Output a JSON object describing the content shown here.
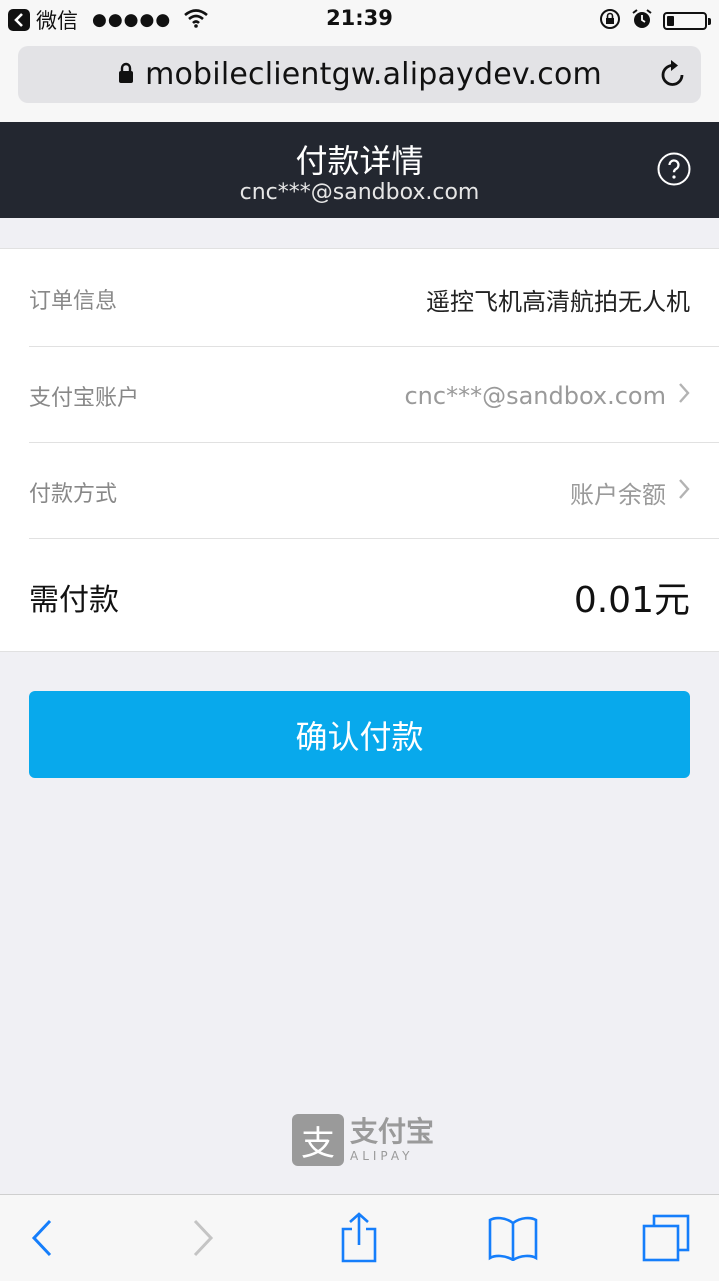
{
  "status_bar": {
    "back_app": "微信",
    "signal": "●●●●●",
    "time": "21:39",
    "battery_level": 0.2
  },
  "browser": {
    "url": "mobileclientgw.alipaydev.com"
  },
  "header": {
    "title": "付款详情",
    "account": "cnc***@sandbox.com",
    "help_icon": "question-circle-icon"
  },
  "details": [
    {
      "label": "订单信息",
      "value": "遥控飞机高清航拍无人机"
    },
    {
      "label": "支付宝账户",
      "value": "cnc***@sandbox.com"
    },
    {
      "label": "付款方式",
      "value": "账户余额"
    }
  ],
  "payment": {
    "label": "需付款",
    "amount": "0.01元"
  },
  "confirm_button": "确认付款",
  "footer_logo": {
    "mark": "支",
    "cn": "支付宝",
    "en": "ALIPAY"
  },
  "colors": {
    "header_bg": "#232730",
    "button_bg": "#08a9ec",
    "page_bg": "#f0f0f4"
  }
}
